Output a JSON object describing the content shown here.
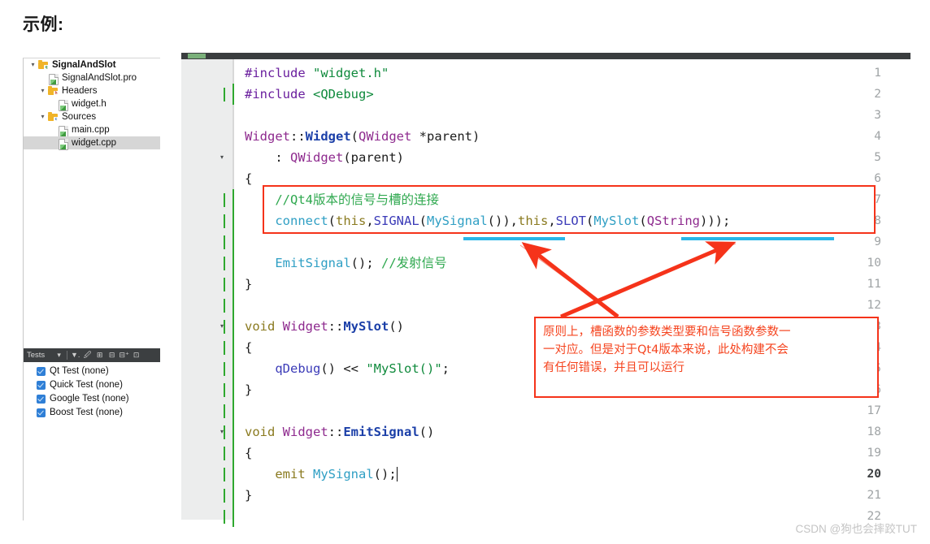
{
  "heading": "示例:",
  "project_tree": {
    "items": [
      {
        "label": "SignalAndSlot",
        "indent": 0,
        "twisty": "▾",
        "icon": "folder-project-icon",
        "bold": true,
        "badge": "q",
        "badge_color": "g",
        "selected": false
      },
      {
        "label": "SignalAndSlot.pro",
        "indent": 1,
        "twisty": "",
        "icon": "file-pro-icon",
        "bold": false,
        "badge": "",
        "badge_color": "",
        "selected": false
      },
      {
        "label": "Headers",
        "indent": 1,
        "twisty": "▾",
        "icon": "folder-headers-icon",
        "bold": false,
        "badge": "h",
        "badge_color": "r",
        "selected": false
      },
      {
        "label": "widget.h",
        "indent": 2,
        "twisty": "",
        "icon": "file-header-icon",
        "bold": false,
        "badge": "",
        "badge_color": "",
        "selected": false
      },
      {
        "label": "Sources",
        "indent": 1,
        "twisty": "▾",
        "icon": "folder-sources-icon",
        "bold": false,
        "badge": "c",
        "badge_color": "b",
        "selected": false
      },
      {
        "label": "main.cpp",
        "indent": 2,
        "twisty": "",
        "icon": "file-cpp-icon",
        "bold": false,
        "badge": "",
        "badge_color": "",
        "selected": false
      },
      {
        "label": "widget.cpp",
        "indent": 2,
        "twisty": "",
        "icon": "file-cpp-icon",
        "bold": false,
        "badge": "",
        "badge_color": "",
        "selected": true
      }
    ]
  },
  "tests_panel": {
    "title": "Tests",
    "toolbar_icons": [
      "chevron-down-icon",
      "filter-icon",
      "run-test-icon",
      "expand-all-icon",
      "collapse-all-icon",
      "add-panel-icon",
      "panel-options-icon"
    ],
    "toolbar_glyphs": [
      "▾",
      "▼.",
      "🖉",
      "⊞",
      "⊟",
      "⊟+",
      "⊡"
    ],
    "rows": [
      {
        "label": "Qt Test (none)",
        "checked": true
      },
      {
        "label": "Quick Test (none)",
        "checked": true
      },
      {
        "label": "Google Test (none)",
        "checked": true
      },
      {
        "label": "Boost Test (none)",
        "checked": true
      }
    ]
  },
  "editor": {
    "current_line": 20,
    "lines": [
      {
        "n": 1,
        "fold": "",
        "caret": false,
        "change": false
      },
      {
        "n": 2,
        "fold": "",
        "caret": true,
        "change": true
      },
      {
        "n": 3,
        "fold": "",
        "caret": false,
        "change": false
      },
      {
        "n": 4,
        "fold": "",
        "caret": false,
        "change": false
      },
      {
        "n": 5,
        "fold": "▾",
        "caret": false,
        "change": false
      },
      {
        "n": 6,
        "fold": "",
        "caret": false,
        "change": false
      },
      {
        "n": 7,
        "fold": "",
        "caret": true,
        "change": true
      },
      {
        "n": 8,
        "fold": "",
        "caret": true,
        "change": true
      },
      {
        "n": 9,
        "fold": "",
        "caret": true,
        "change": true
      },
      {
        "n": 10,
        "fold": "",
        "caret": true,
        "change": true
      },
      {
        "n": 11,
        "fold": "",
        "caret": true,
        "change": true
      },
      {
        "n": 12,
        "fold": "",
        "caret": true,
        "change": true
      },
      {
        "n": 13,
        "fold": "▾",
        "caret": true,
        "change": true
      },
      {
        "n": 14,
        "fold": "",
        "caret": true,
        "change": true
      },
      {
        "n": 15,
        "fold": "",
        "caret": true,
        "change": true
      },
      {
        "n": 16,
        "fold": "",
        "caret": true,
        "change": true
      },
      {
        "n": 17,
        "fold": "",
        "caret": true,
        "change": true
      },
      {
        "n": 18,
        "fold": "▾",
        "caret": true,
        "change": true
      },
      {
        "n": 19,
        "fold": "",
        "caret": true,
        "change": true
      },
      {
        "n": 20,
        "fold": "",
        "caret": true,
        "change": true
      },
      {
        "n": 21,
        "fold": "",
        "caret": true,
        "change": true
      },
      {
        "n": 22,
        "fold": "",
        "caret": true,
        "change": true
      }
    ],
    "code": {
      "l1": "#include \"widget.h\"",
      "l2": "#include <QDebug>",
      "l4": "Widget::Widget(QWidget *parent)",
      "l5": "    : QWidget(parent)",
      "l6": "{",
      "l7": "    //Qt4版本的信号与槽的连接",
      "l8": "    connect(this,SIGNAL(MySignal()),this,SLOT(MySlot(QString)));",
      "l10": "    EmitSignal(); //发射信号",
      "l11": "}",
      "l13": "void Widget::MySlot()",
      "l14": "{",
      "l15": "    qDebug() << \"MySlot()\";",
      "l16": "}",
      "l18": "void Widget::EmitSignal()",
      "l19": "{",
      "l20": "    emit MySignal();",
      "l21": "}"
    }
  },
  "annotation": {
    "note_text_line1": "原则上，槽函数的参数类型要和信号函数参数一",
    "note_text_line2": "一对应。但是对于Qt4版本来说，此处构建不会",
    "note_text_line3": "有任何错误，并且可以运行",
    "highlight_color": "#f5331a",
    "underline_color": "#29b6e8",
    "underlined_terms": [
      "MySignal()",
      "MySlot(QString)"
    ]
  },
  "watermark": "CSDN @狗也会摔跤TUT"
}
